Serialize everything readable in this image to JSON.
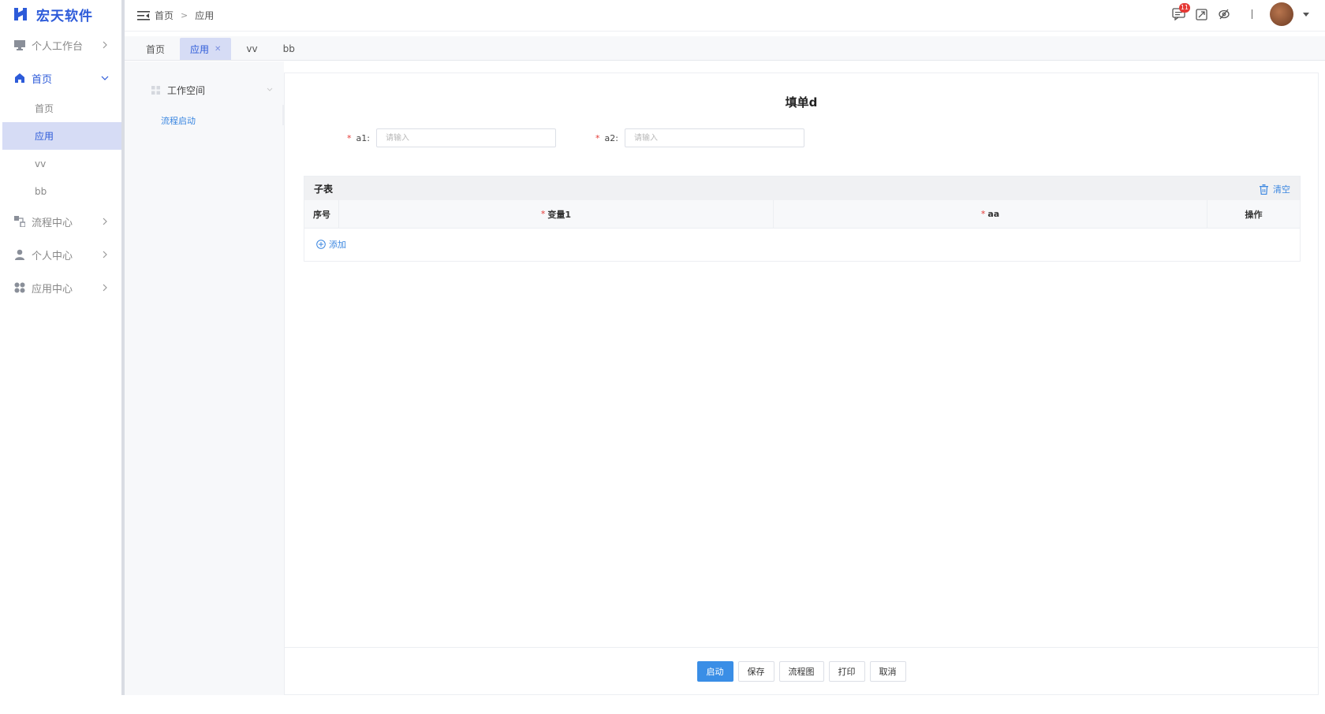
{
  "app": {
    "logo_text": "宏天软件",
    "brand_color": "#2d5bd9"
  },
  "sidebar": {
    "items": [
      {
        "label": "个人工作台",
        "icon": "monitor-icon"
      },
      {
        "label": "首页",
        "icon": "home-icon",
        "expanded": true,
        "children": [
          {
            "label": "首页"
          },
          {
            "label": "应用",
            "selected": true
          },
          {
            "label": "vv"
          },
          {
            "label": "bb"
          }
        ]
      },
      {
        "label": "流程中心",
        "icon": "flow-icon"
      },
      {
        "label": "个人中心",
        "icon": "user-icon"
      },
      {
        "label": "应用中心",
        "icon": "apps-icon"
      }
    ]
  },
  "header": {
    "breadcrumb": [
      "首页",
      "应用"
    ],
    "breadcrumb_sep": ">",
    "notification_count": "11"
  },
  "tabs": [
    {
      "label": "首页"
    },
    {
      "label": "应用",
      "active": true,
      "closable": true
    },
    {
      "label": "vv"
    },
    {
      "label": "bb"
    }
  ],
  "subpanel": {
    "title": "工作空间",
    "link": "流程启动"
  },
  "form": {
    "title": "填单d",
    "fields": [
      {
        "label": "a1:",
        "placeholder": "请输入",
        "required": true
      },
      {
        "label": "a2:",
        "placeholder": "请输入",
        "required": true
      }
    ],
    "subtable": {
      "title": "子表",
      "clear_label": "清空",
      "columns": [
        "序号",
        "变量1",
        "aa",
        "操作"
      ],
      "add_label": "添加"
    }
  },
  "footer": {
    "buttons": [
      "启动",
      "保存",
      "流程图",
      "打印",
      "取消"
    ]
  }
}
